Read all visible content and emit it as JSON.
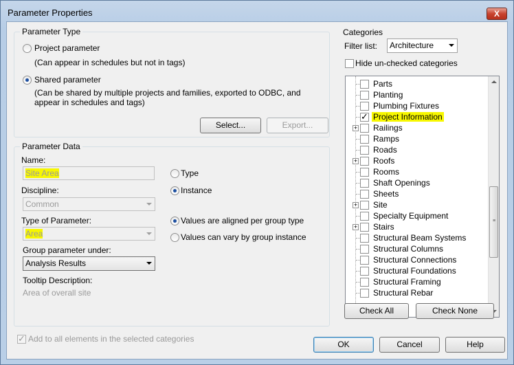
{
  "window": {
    "title": "Parameter Properties",
    "close_label": "X"
  },
  "parameter_type": {
    "label": "Parameter Type",
    "project": {
      "label": "Project parameter",
      "desc": "(Can appear in schedules but not in tags)",
      "checked": false
    },
    "shared": {
      "label": "Shared parameter",
      "desc_line1": "(Can be shared by multiple projects and families, exported to ODBC, and",
      "desc_line2": "appear in schedules and tags)",
      "checked": true
    },
    "select_button": "Select...",
    "export_button": "Export..."
  },
  "parameter_data": {
    "label": "Parameter Data",
    "name_label": "Name:",
    "name_value": "Site Area",
    "discipline_label": "Discipline:",
    "discipline_value": "Common",
    "type_label": "Type of Parameter:",
    "type_value": "Area",
    "group_label": "Group parameter under:",
    "group_value": "Analysis Results",
    "tooltip_label": "Tooltip Description:",
    "tooltip_value": "Area of overall site",
    "type_radio": "Type",
    "instance_radio": "Instance",
    "aligned_radio": "Values are aligned per group type",
    "vary_radio": "Values can vary by group instance"
  },
  "categories": {
    "label": "Categories",
    "filter_label": "Filter list:",
    "filter_value": "Architecture",
    "hide_label": "Hide un-checked categories",
    "items": [
      {
        "label": "Parts",
        "checked": false,
        "expandable": false,
        "highlight": false
      },
      {
        "label": "Planting",
        "checked": false,
        "expandable": false,
        "highlight": false
      },
      {
        "label": "Plumbing Fixtures",
        "checked": false,
        "expandable": false,
        "highlight": false
      },
      {
        "label": "Project Information",
        "checked": true,
        "expandable": false,
        "highlight": true
      },
      {
        "label": "Railings",
        "checked": false,
        "expandable": true,
        "highlight": false
      },
      {
        "label": "Ramps",
        "checked": false,
        "expandable": false,
        "highlight": false
      },
      {
        "label": "Roads",
        "checked": false,
        "expandable": false,
        "highlight": false
      },
      {
        "label": "Roofs",
        "checked": false,
        "expandable": true,
        "highlight": false
      },
      {
        "label": "Rooms",
        "checked": false,
        "expandable": false,
        "highlight": false
      },
      {
        "label": "Shaft Openings",
        "checked": false,
        "expandable": false,
        "highlight": false
      },
      {
        "label": "Sheets",
        "checked": false,
        "expandable": false,
        "highlight": false
      },
      {
        "label": "Site",
        "checked": false,
        "expandable": true,
        "highlight": false
      },
      {
        "label": "Specialty Equipment",
        "checked": false,
        "expandable": false,
        "highlight": false
      },
      {
        "label": "Stairs",
        "checked": false,
        "expandable": true,
        "highlight": false
      },
      {
        "label": "Structural Beam Systems",
        "checked": false,
        "expandable": false,
        "highlight": false
      },
      {
        "label": "Structural Columns",
        "checked": false,
        "expandable": false,
        "highlight": false
      },
      {
        "label": "Structural Connections",
        "checked": false,
        "expandable": false,
        "highlight": false
      },
      {
        "label": "Structural Foundations",
        "checked": false,
        "expandable": false,
        "highlight": false
      },
      {
        "label": "Structural Framing",
        "checked": false,
        "expandable": false,
        "highlight": false
      },
      {
        "label": "Structural Rebar",
        "checked": false,
        "expandable": false,
        "highlight": false
      }
    ],
    "check_all": "Check All",
    "check_none": "Check None"
  },
  "footer": {
    "add_all_label": "Add to all elements in the selected categories",
    "ok": "OK",
    "cancel": "Cancel",
    "help": "Help"
  },
  "colors": {
    "highlight": "#f7f700",
    "default_button_border": "#3c7fb1"
  }
}
